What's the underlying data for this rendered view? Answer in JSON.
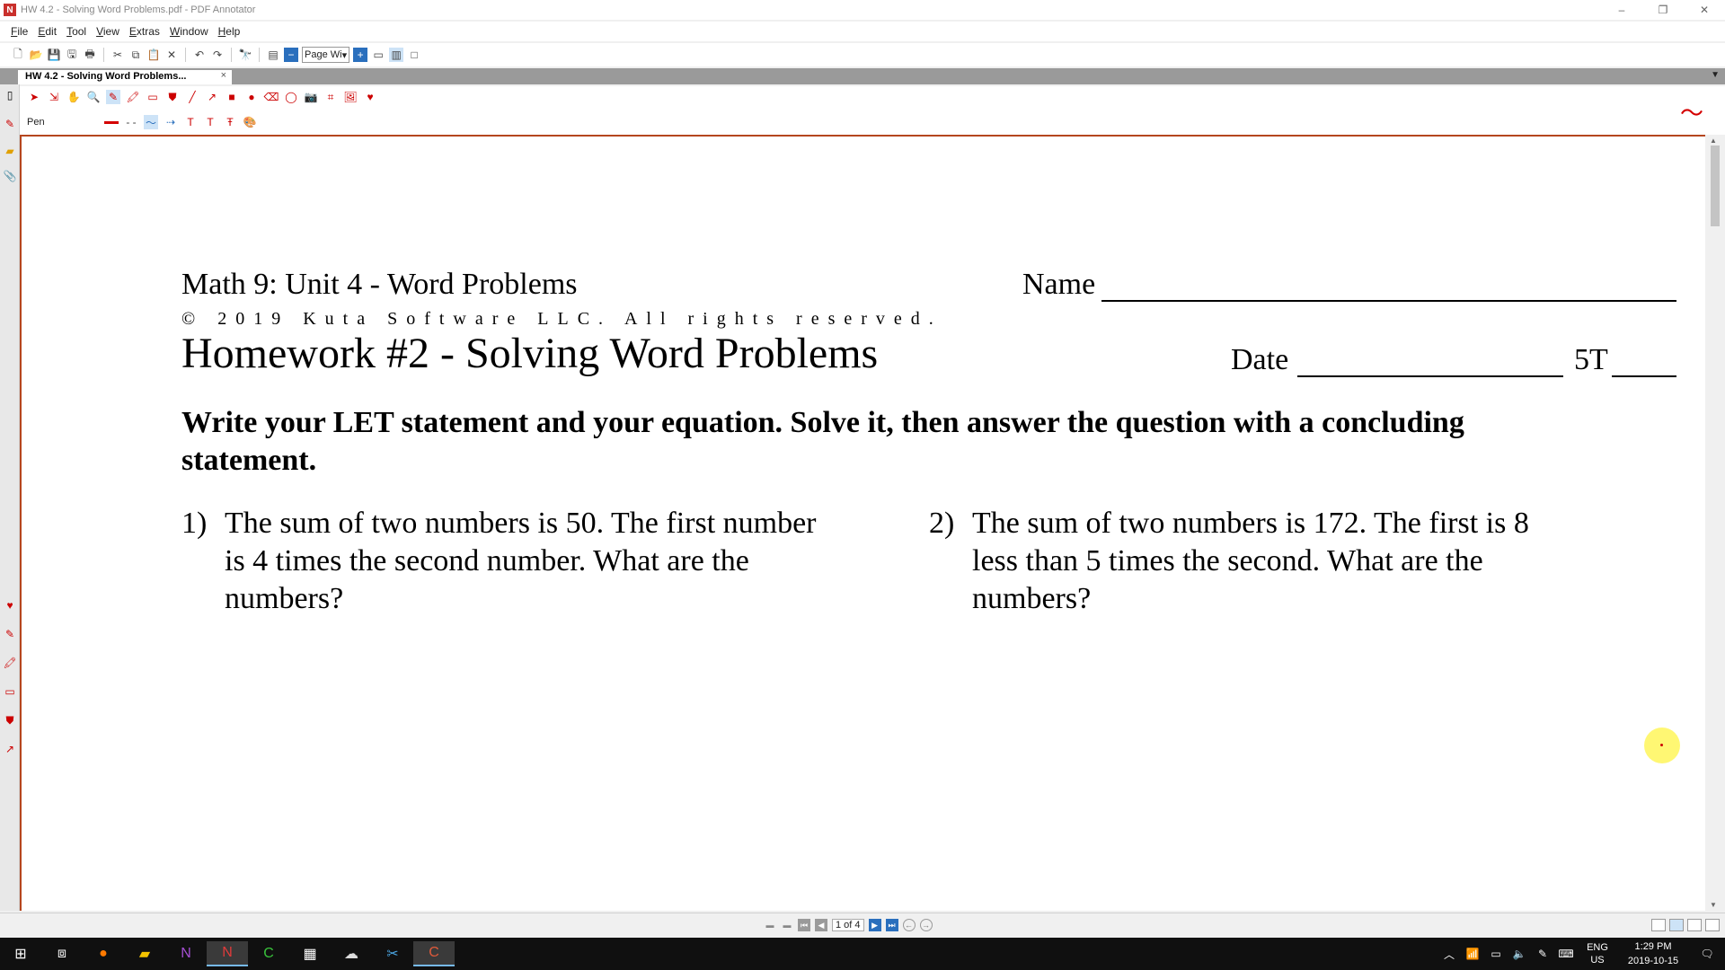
{
  "window": {
    "title": "HW 4.2 - Solving Word Problems.pdf - PDF Annotator",
    "minimize": "–",
    "restore": "❐",
    "close": "✕"
  },
  "menu": [
    "File",
    "Edit",
    "Tool",
    "View",
    "Extras",
    "Window",
    "Help"
  ],
  "toolbar": {
    "zoom_value": "Page Wi"
  },
  "tab": {
    "label": "HW 4.2 - Solving Word Problems...",
    "close": "×"
  },
  "annotation_toolbar": {
    "current_tool": "Pen"
  },
  "document": {
    "title": "Math 9: Unit 4 - Word Problems",
    "name_label": "Name",
    "copyright": "© 2019 Kuta Software LLC. All rights reserved.",
    "homework_title": "Homework #2 - Solving Word Problems",
    "date_label": "Date",
    "period_label": "5T",
    "instructions": "Write your LET statement and your equation. Solve it, then answer the question with a concluding statement.",
    "problems": [
      {
        "number": "1)",
        "text": "The sum of two numbers is 50. The first number is 4 times the second number. What are the numbers?"
      },
      {
        "number": "2)",
        "text": "The sum of two numbers is 172. The first is 8 less than 5 times the second. What are the numbers?"
      }
    ]
  },
  "status": {
    "page_counter": "1 of 4"
  },
  "taskbar": {
    "lang_top": "ENG",
    "lang_bottom": "US",
    "time": "1:29 PM",
    "date": "2019-10-15"
  },
  "colors": {
    "accent_border": "#b5461e",
    "pen_color": "#d40000",
    "taskbar_bg": "#101010"
  }
}
